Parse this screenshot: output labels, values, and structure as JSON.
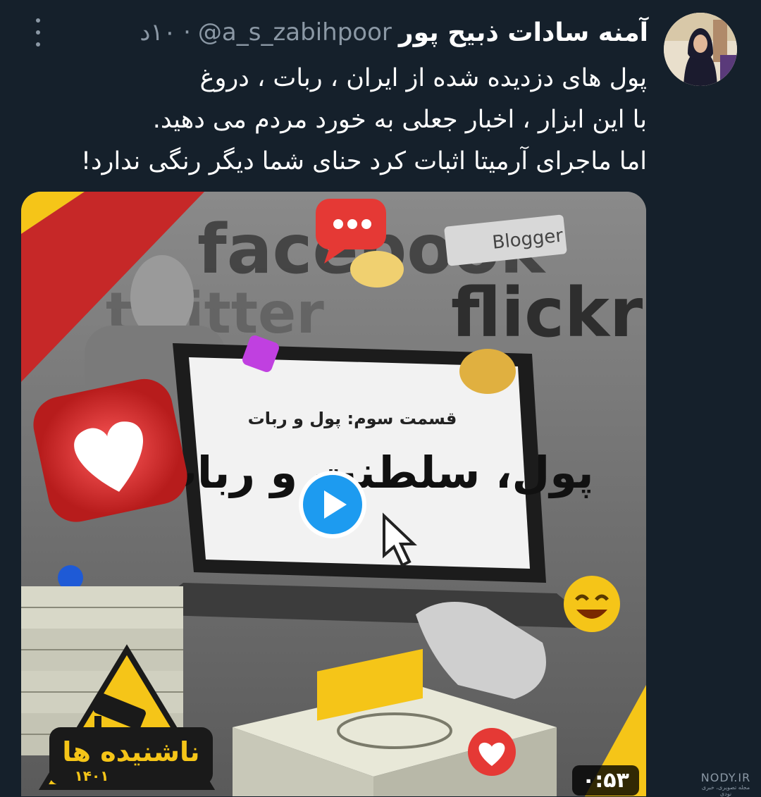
{
  "tweet": {
    "author_name": "آمنه سادات ذبیح پور",
    "handle": "@a_s_zabihpoor",
    "separator": "·",
    "time": "۱۰د",
    "text_lines": [
      "پول های دزدیده شده از ایران ، ربات ، دروغ",
      "با این ابزار ، اخبار جعلی به خورد مردم می دهید.",
      "اما ماجرای آرمیتا اثبات کرد حنای شما دیگر رنگی ندارد!"
    ]
  },
  "media": {
    "duration": "۰:۵۳",
    "screen_subtitle": "قسمت سوم: پول و ربات",
    "screen_title": "پول، سلطنت و ربات",
    "background_words": [
      "facebook",
      "Blogger",
      "flickr",
      "twitter"
    ],
    "badge_title": "ناشنیده ها",
    "badge_year": "۱۴۰۱"
  },
  "watermark": {
    "title": "NODY.IR",
    "subtitle": "مجله تصویری، خبری نودی"
  },
  "icons": {
    "more": "more-vertical-icon",
    "play": "play-icon",
    "heart": "heart-icon",
    "chat": "chat-bubble-icon",
    "camera": "cctv-camera-icon",
    "cursor": "mouse-cursor-icon"
  },
  "colors": {
    "background": "#15202b",
    "text": "#ffffff",
    "secondary_text": "#8b98a5",
    "accent": "#1d9bf0",
    "poster_yellow": "#f5c518",
    "poster_red": "#c62828"
  }
}
